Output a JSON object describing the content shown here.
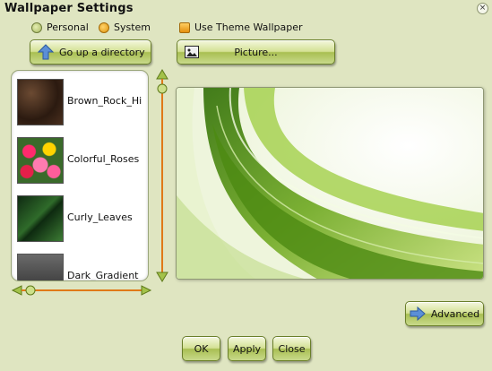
{
  "window": {
    "title": "Wallpaper Settings"
  },
  "source": {
    "personal_label": "Personal",
    "system_label": "System",
    "selected": "System",
    "use_theme_label": "Use Theme Wallpaper",
    "use_theme_checked": true
  },
  "toolbar": {
    "up_directory_label": "Go up a directory",
    "picture_label": "Picture..."
  },
  "wallpapers": [
    {
      "name": "Brown_Rock_Hi"
    },
    {
      "name": "Colorful_Roses"
    },
    {
      "name": "Curly_Leaves"
    },
    {
      "name": "Dark_Gradient"
    }
  ],
  "buttons": {
    "advanced_label": "Advanced",
    "ok_label": "OK",
    "apply_label": "Apply",
    "close_label": "Close"
  },
  "colors": {
    "background": "#dfe5c1",
    "accent_green": "#8db23a",
    "slider_orange": "#e07a18"
  }
}
